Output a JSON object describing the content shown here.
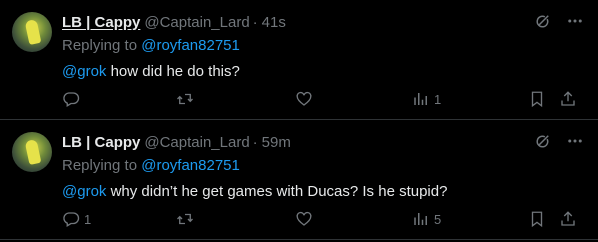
{
  "tweets": [
    {
      "display_name": "LB | Cappy",
      "handle": "@Captain_Lard",
      "dot": "·",
      "time": "41s",
      "replying_prefix": "Replying to ",
      "replying_handle": "@royfan82751",
      "mention": "@grok",
      "text": " how did he do this?",
      "reply_count": "",
      "retweet_count": "",
      "like_count": "",
      "view_count": "1"
    },
    {
      "display_name": "LB | Cappy",
      "handle": "@Captain_Lard",
      "dot": "·",
      "time": "59m",
      "replying_prefix": "Replying to ",
      "replying_handle": "@royfan82751",
      "mention": "@grok",
      "text": " why didn’t he get games with Ducas? Is he stupid?",
      "reply_count": "1",
      "retweet_count": "",
      "like_count": "",
      "view_count": "5"
    }
  ],
  "colors": {
    "background": "#000000",
    "text": "#e7e9ea",
    "muted": "#71767b",
    "link": "#1d9bf0",
    "divider": "#2f3336"
  },
  "icons": {
    "grok": "grok-icon",
    "more": "more-icon",
    "reply": "reply-icon",
    "retweet": "retweet-icon",
    "like": "like-icon",
    "views": "views-icon",
    "bookmark": "bookmark-icon",
    "share": "share-icon"
  }
}
